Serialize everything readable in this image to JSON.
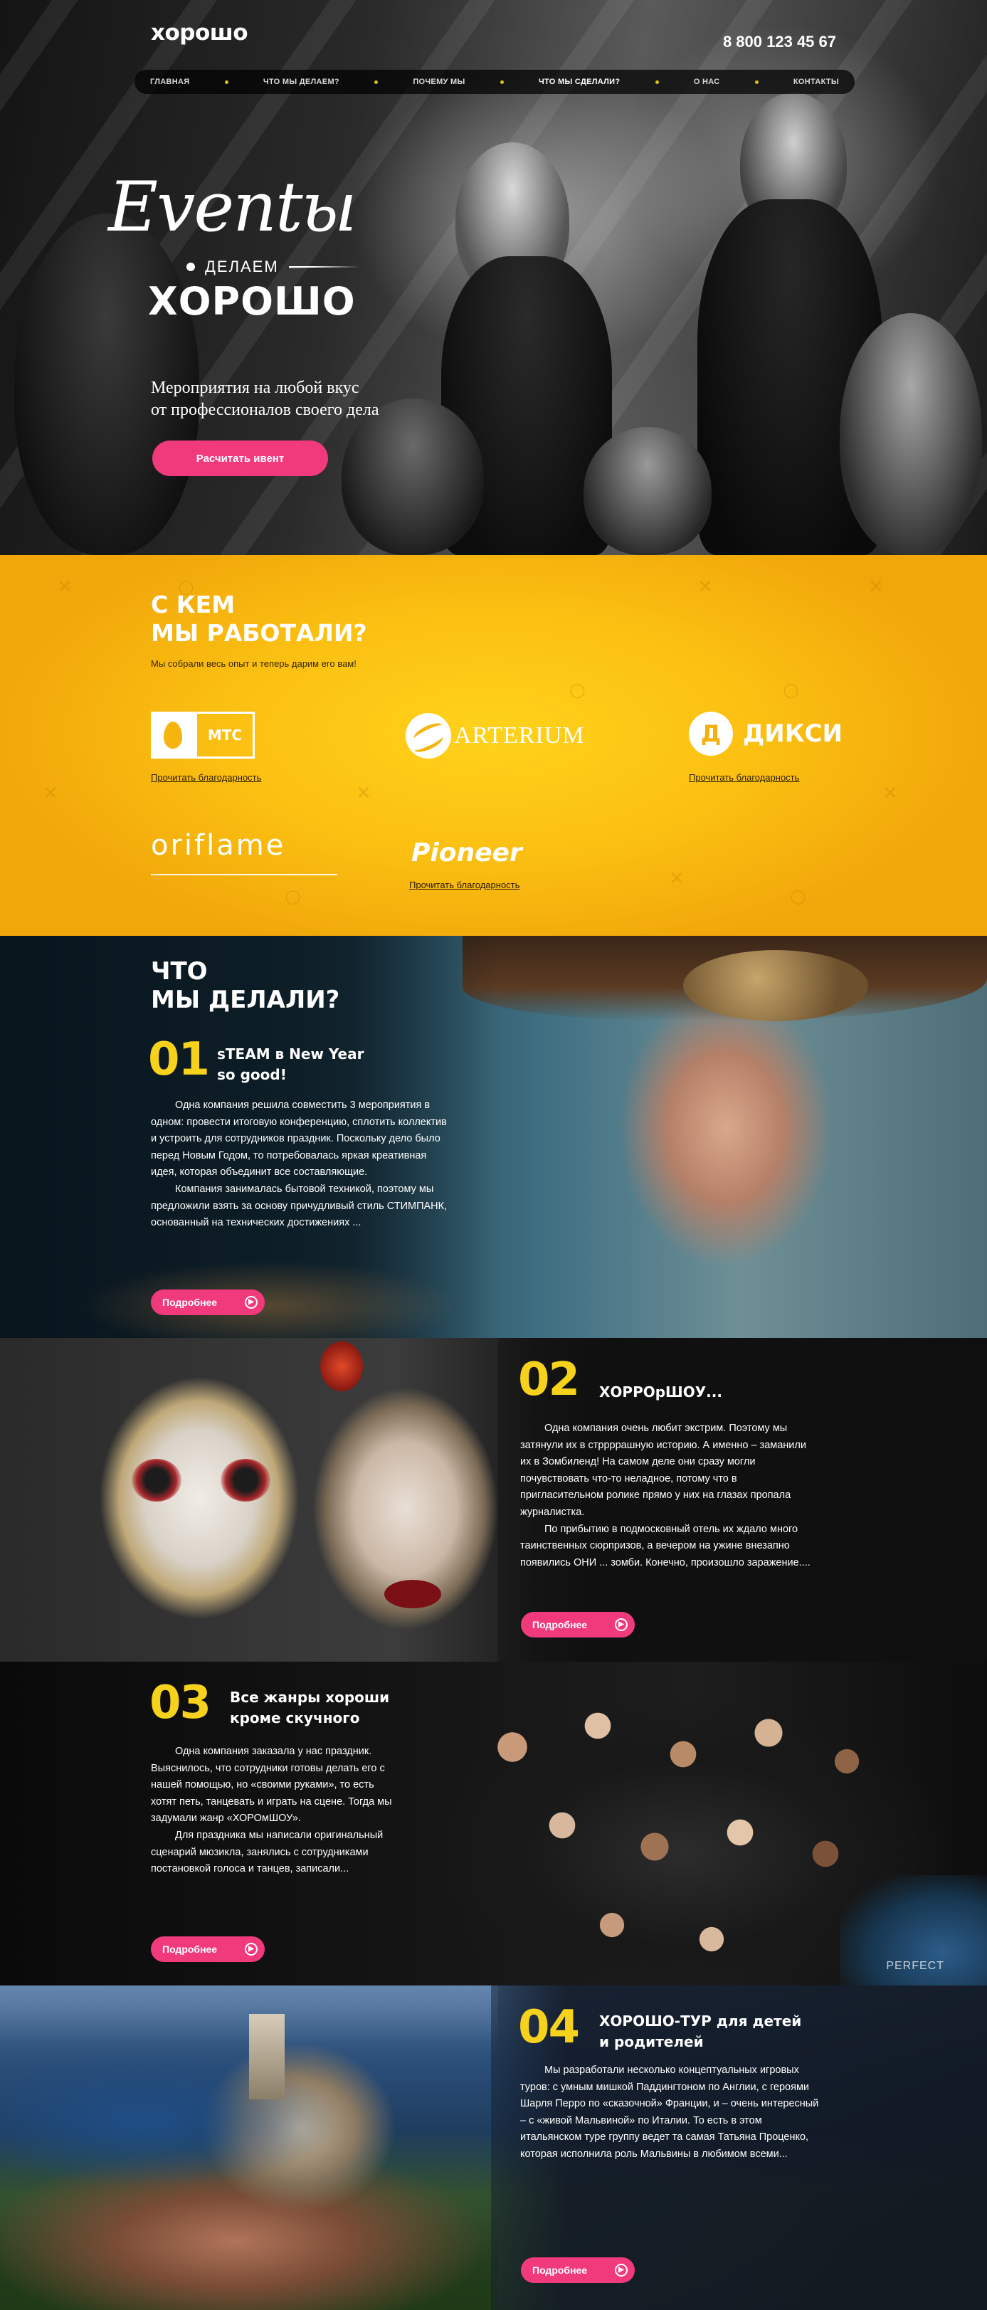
{
  "header": {
    "logo": "хорошо",
    "phone": "8 800 123 45 67",
    "nav": [
      {
        "label": "ГЛАВНАЯ",
        "active": false
      },
      {
        "label": "ЧТО МЫ ДЕЛАЕМ?",
        "active": false
      },
      {
        "label": "ПОЧЕМУ МЫ",
        "active": false
      },
      {
        "label": "ЧТО МЫ СДЕЛАЛИ?",
        "active": true
      },
      {
        "label": "О НАС",
        "active": false
      },
      {
        "label": "КОНТАКТЫ",
        "active": false
      }
    ]
  },
  "hero": {
    "script_title": "Eventы",
    "sub": "ДЕЛАЕМ",
    "title": "ХОРОШО",
    "tagline_1": "Мероприятия на любой вкус",
    "tagline_2": "от профессионалов своего дела",
    "cta": "Расчитать ивент"
  },
  "clients": {
    "title_1": "С КЕМ",
    "title_2": "МЫ РАБОТАЛИ?",
    "subtitle": "Мы собрали весь опыт и теперь дарим его вам!",
    "logos": {
      "mts": "МТС",
      "arterium": "ARTERIUM",
      "dixi_letter": "Д",
      "dixi": "ДИКСИ",
      "oriflame": "oriflame",
      "pioneer": "Pioneer"
    },
    "thanks_label": "Прочитать благодарность"
  },
  "cases": {
    "section_title_1": "ЧТО",
    "section_title_2": "МЫ ДЕЛАЛИ?",
    "more_label": "Подробнее",
    "items": [
      {
        "num": "01",
        "title_1": "sTEAM в New Year",
        "title_2": "so good!",
        "para_1": "Одна компания решила совместить 3 мероприятия в одном: провести итоговую конференцию, сплотить коллектив и устроить для сотрудников праздник. Поскольку дело было перед Новым Годом, то потребовалась яркая креативная идея, которая объединит все составляющие.",
        "para_2": "Компания занималась бытовой техникой, поэтому мы предложили взять за основу причудливый стиль СТИМПАНК, основанный на технических достижениях ..."
      },
      {
        "num": "02",
        "title_1": "ХОРРОрШОУ...",
        "title_2": "",
        "para_1": "Одна компания очень любит экстрим. Поэтому мы затянули их в стррррашную историю. А именно – заманили их в Зомбиленд! На самом деле они сразу могли почувствовать что-то неладное, потому что в пригласительном ролике прямо у них на глазах пропала журналистка.",
        "para_2": "По прибытию в подмосковный отель их ждало много таинственных сюрпризов, а вечером на ужине внезапно появились ОНИ ... зомби. Конечно, произошло заражение...."
      },
      {
        "num": "03",
        "title_1": "Все жанры хороши",
        "title_2": "кроме скучного",
        "para_1": "Одна компания заказала у нас праздник. Выяснилось, что сотрудники готовы делать его с нашей помощью, но «своими руками», то есть хотят петь, танцевать и играть на сцене. Тогда мы задумали жанр «ХОРОмШОУ».",
        "para_2": "Для праздника мы написали оригинальный сценарий мюзикла, занялись с сотрудниками постановкой голоса и танцев, записали..."
      },
      {
        "num": "04",
        "title_1": "ХОРОШО-ТУР для детей",
        "title_2": "и родителей",
        "para_1": "Мы разработали несколько концептуальных игровых туров: с умным мишкой Паддингтоном по Англии, с героями Шарля Перро по «сказочной» Франции, и – очень интересный – с «живой Мальвиной» по Италии. То есть в этом итальянском туре группу ведет та самая Татьяна Проценко, которая исполнила роль Мальвины в любимом всеми...",
        "para_2": ""
      }
    ],
    "watermark": "PERFECT"
  }
}
